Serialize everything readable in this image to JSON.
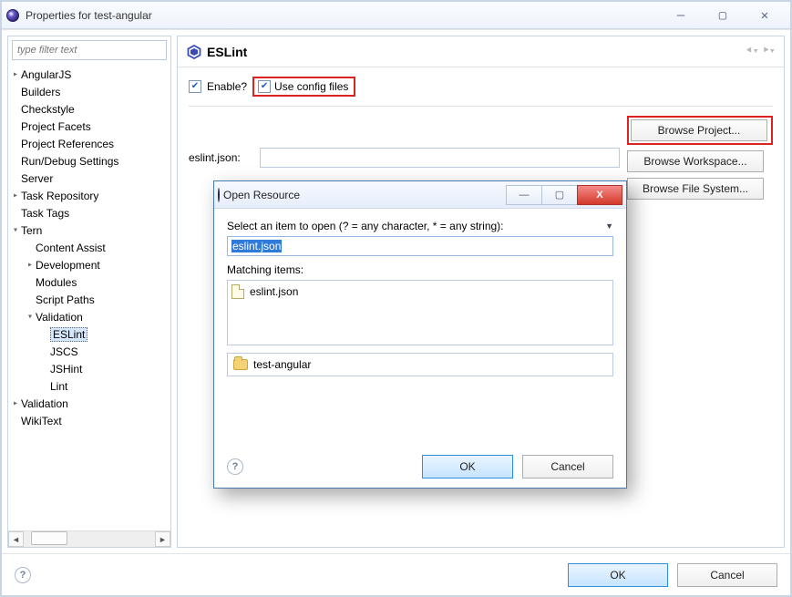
{
  "window": {
    "title": "Properties for test-angular"
  },
  "sidebar": {
    "filter_placeholder": "type filter text",
    "items": [
      {
        "label": "AngularJS",
        "depth": 1,
        "twisty": ">"
      },
      {
        "label": "Builders",
        "depth": 1,
        "twisty": " "
      },
      {
        "label": "Checkstyle",
        "depth": 1,
        "twisty": " "
      },
      {
        "label": "Project Facets",
        "depth": 1,
        "twisty": " "
      },
      {
        "label": "Project References",
        "depth": 1,
        "twisty": " "
      },
      {
        "label": "Run/Debug Settings",
        "depth": 1,
        "twisty": " "
      },
      {
        "label": "Server",
        "depth": 1,
        "twisty": " "
      },
      {
        "label": "Task Repository",
        "depth": 1,
        "twisty": ">"
      },
      {
        "label": "Task Tags",
        "depth": 1,
        "twisty": " "
      },
      {
        "label": "Tern",
        "depth": 1,
        "twisty": "▴"
      },
      {
        "label": "Content Assist",
        "depth": 2,
        "twisty": " "
      },
      {
        "label": "Development",
        "depth": 2,
        "twisty": ">"
      },
      {
        "label": "Modules",
        "depth": 2,
        "twisty": " "
      },
      {
        "label": "Script Paths",
        "depth": 2,
        "twisty": " "
      },
      {
        "label": "Validation",
        "depth": 2,
        "twisty": "▴"
      },
      {
        "label": "ESLint",
        "depth": 3,
        "twisty": " ",
        "selected": true
      },
      {
        "label": "JSCS",
        "depth": 3,
        "twisty": " "
      },
      {
        "label": "JSHint",
        "depth": 3,
        "twisty": " "
      },
      {
        "label": "Lint",
        "depth": 3,
        "twisty": " "
      },
      {
        "label": "Validation",
        "depth": 1,
        "twisty": ">"
      },
      {
        "label": "WikiText",
        "depth": 1,
        "twisty": " "
      }
    ]
  },
  "page": {
    "title": "ESLint",
    "enable_label": "Enable?",
    "use_config_label": "Use config files",
    "enable_checked": true,
    "use_config_checked": true,
    "field_label": "eslint.json:",
    "field_value": "",
    "browse_project": "Browse Project...",
    "browse_workspace": "Browse Workspace...",
    "browse_filesystem": "Browse File System..."
  },
  "dialog": {
    "title": "Open Resource",
    "prompt": "Select an item to open (? = any character, * = any string):",
    "input_value": "eslint.json",
    "matching_label": "Matching items:",
    "match_item": "eslint.json",
    "container": "test-angular",
    "ok": "OK",
    "cancel": "Cancel"
  },
  "footer": {
    "ok": "OK",
    "cancel": "Cancel"
  }
}
